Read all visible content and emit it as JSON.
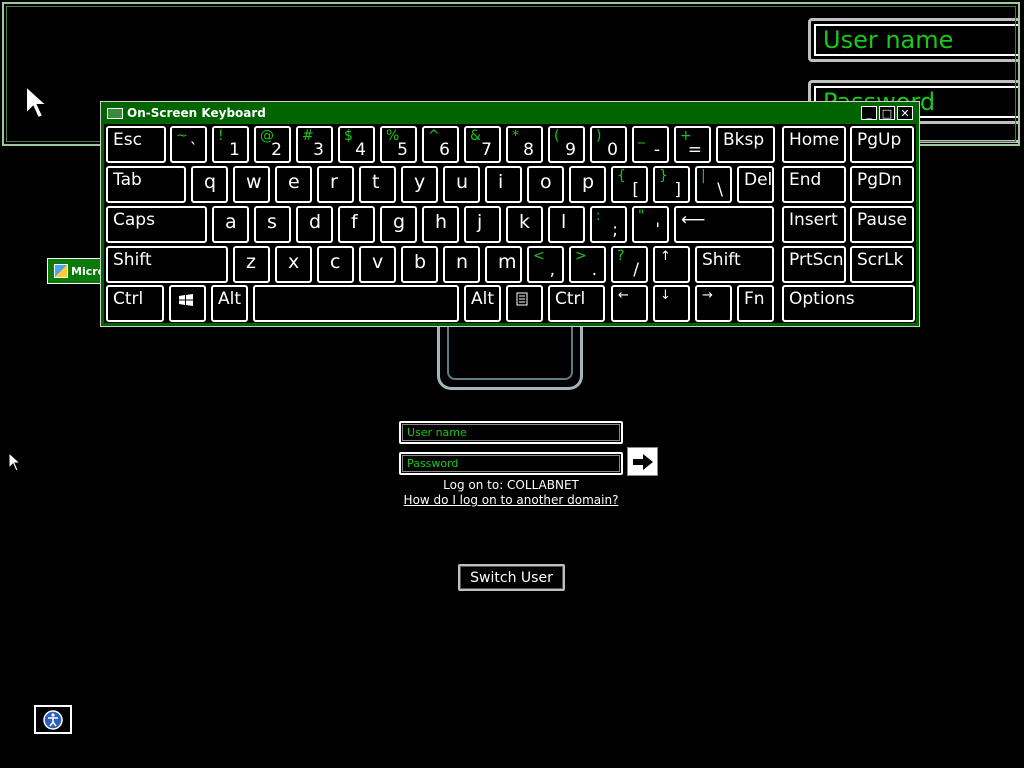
{
  "magnifier": {
    "user_name_text": "User name",
    "password_text": "Password"
  },
  "taskbar_item": {
    "label": "Micro"
  },
  "osk": {
    "title": "On-Screen Keyboard",
    "controls": {
      "minimize": "_",
      "maximize": "□",
      "close": "✕"
    },
    "rows": [
      [
        {
          "label": "Esc"
        },
        {
          "shift": "~",
          "main": "`"
        },
        {
          "shift": "!",
          "main": "1"
        },
        {
          "shift": "@",
          "main": "2"
        },
        {
          "shift": "#",
          "main": "3"
        },
        {
          "shift": "$",
          "main": "4"
        },
        {
          "shift": "%",
          "main": "5"
        },
        {
          "shift": "^",
          "main": "6"
        },
        {
          "shift": "&",
          "main": "7"
        },
        {
          "shift": "*",
          "main": "8"
        },
        {
          "shift": "(",
          "main": "9"
        },
        {
          "shift": ")",
          "main": "0"
        },
        {
          "shift": "_",
          "main": "-"
        },
        {
          "shift": "+",
          "main": "="
        },
        {
          "label": "Bksp"
        },
        {
          "label": "Home"
        },
        {
          "label": "PgUp"
        }
      ],
      [
        {
          "label": "Tab"
        },
        {
          "label": "q"
        },
        {
          "label": "w"
        },
        {
          "label": "e"
        },
        {
          "label": "r"
        },
        {
          "label": "t"
        },
        {
          "label": "y"
        },
        {
          "label": "u"
        },
        {
          "label": "i"
        },
        {
          "label": "o"
        },
        {
          "label": "p"
        },
        {
          "shift": "{",
          "main": "["
        },
        {
          "shift": "}",
          "main": "]"
        },
        {
          "shift": "|",
          "main": "\\"
        },
        {
          "label": "Del"
        },
        {
          "label": "End"
        },
        {
          "label": "PgDn"
        }
      ],
      [
        {
          "label": "Caps"
        },
        {
          "label": "a"
        },
        {
          "label": "s"
        },
        {
          "label": "d"
        },
        {
          "label": "f"
        },
        {
          "label": "g"
        },
        {
          "label": "h"
        },
        {
          "label": "j"
        },
        {
          "label": "k"
        },
        {
          "label": "l"
        },
        {
          "shift": ":",
          "main": ";"
        },
        {
          "shift": "\"",
          "main": "'"
        },
        {
          "label": "⟵"
        },
        {
          "label": "Insert"
        },
        {
          "label": "Pause"
        }
      ],
      [
        {
          "label": "Shift"
        },
        {
          "label": "z"
        },
        {
          "label": "x"
        },
        {
          "label": "c"
        },
        {
          "label": "v"
        },
        {
          "label": "b"
        },
        {
          "label": "n"
        },
        {
          "label": "m"
        },
        {
          "shift": "<",
          "main": ","
        },
        {
          "shift": ">",
          "main": "."
        },
        {
          "shift": "?",
          "main": "/"
        },
        {
          "label": "↑"
        },
        {
          "label": "Shift"
        },
        {
          "label": "PrtScn"
        },
        {
          "label": "ScrLk"
        }
      ],
      [
        {
          "label": "Ctrl"
        },
        {
          "label": "windows-icon",
          "icon": true
        },
        {
          "label": "Alt"
        },
        {
          "label": ""
        },
        {
          "label": "Alt"
        },
        {
          "label": "menu-icon",
          "icon": true
        },
        {
          "label": "Ctrl"
        },
        {
          "label": "←"
        },
        {
          "label": "↓"
        },
        {
          "label": "→"
        },
        {
          "label": "Fn"
        },
        {
          "label": "Options"
        }
      ]
    ]
  },
  "login": {
    "username_placeholder": "User name",
    "password_placeholder": "Password",
    "logon_to": "Log on to: COLLABNET",
    "domain_link": "How do I log on to another domain?",
    "switch_user": "Switch User"
  },
  "colors": {
    "accent_green": "#17c817",
    "titlebar_green": "#006400",
    "background": "#000000"
  }
}
